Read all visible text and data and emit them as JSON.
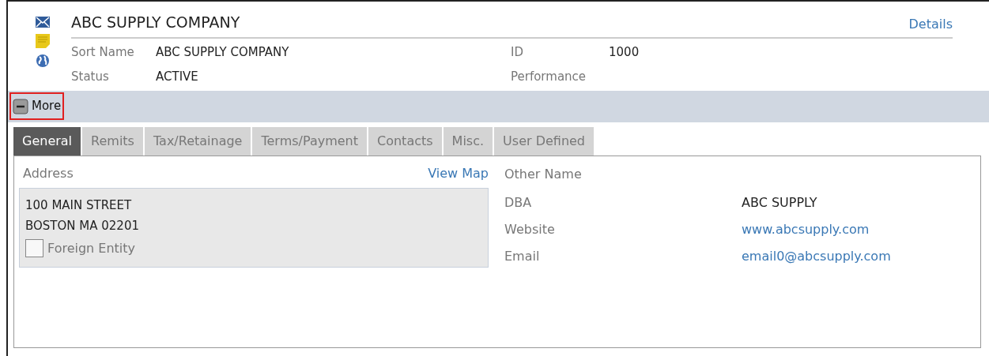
{
  "header": {
    "title": "ABC SUPPLY COMPANY",
    "details_link": "Details",
    "fields": [
      {
        "label": "Sort Name",
        "value": "ABC SUPPLY COMPANY"
      },
      {
        "label": "Status",
        "value": "ACTIVE"
      }
    ],
    "right_fields": [
      {
        "label": "ID",
        "value": "1000"
      },
      {
        "label": "Performance"
      }
    ]
  },
  "more_button": {
    "label": "More",
    "expanded": true,
    "highlighted": true
  },
  "tabs": [
    {
      "label": "General",
      "selected": true
    },
    {
      "label": "Remits",
      "selected": false
    },
    {
      "label": "Tax/Retainage",
      "selected": false
    },
    {
      "label": "Terms/Payment",
      "selected": false
    },
    {
      "label": "Contacts",
      "selected": false
    },
    {
      "label": "Misc.",
      "selected": false
    },
    {
      "label": "User Defined",
      "selected": false
    }
  ],
  "address": {
    "label": "Address",
    "view_map": "View Map",
    "lines": [
      "100 MAIN STREET",
      "BOSTON MA 02201"
    ],
    "foreign_entity": {
      "label": "Foreign Entity",
      "checked": false
    }
  },
  "other": {
    "label": "Other Name",
    "fields": [
      {
        "label": "DBA",
        "value": "ABC SUPPLY",
        "kind": "text"
      },
      {
        "label": "Website",
        "value": "www.abcsupply.com",
        "kind": "link"
      },
      {
        "label": "Email",
        "value": "email0@abcsupply.com",
        "kind": "link"
      }
    ]
  }
}
